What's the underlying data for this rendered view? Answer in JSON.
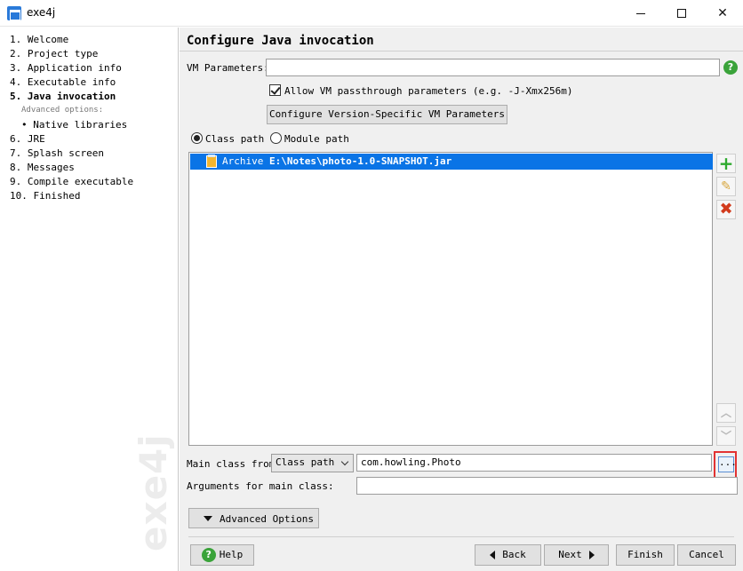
{
  "window": {
    "title": "exe4j",
    "watermark": "exe4j"
  },
  "sidebar": {
    "steps": [
      "1. Welcome",
      "2. Project type",
      "3. Application info",
      "4. Executable info",
      "5. Java invocation",
      "Advanced options:",
      "• Native libraries",
      "6. JRE",
      "7. Splash screen",
      "8. Messages",
      "9. Compile executable",
      "10. Finished"
    ]
  },
  "main": {
    "title": "Configure Java invocation",
    "vm_label": "VM Parameters:",
    "vm_value": "",
    "passthrough_label": "Allow VM passthrough parameters (e.g. -J-Xmx256m)",
    "version_button": "Configure Version-Specific VM Parameters",
    "class_path_label": "Class path",
    "module_path_label": "Module path",
    "entry_type": "Archive",
    "entry_path": "E:\\Notes\\photo-1.0-SNAPSHOT.jar",
    "main_class_label": "Main class from",
    "main_class_source": "Class path",
    "main_class_value": "com.howling.Photo",
    "browse_glyph": "...",
    "args_label": "Arguments for main class:",
    "args_value": "",
    "advanced_button": "Advanced Options"
  },
  "footer": {
    "help": "Help",
    "back": "Back",
    "next": "Next",
    "finish": "Finish",
    "cancel": "Cancel"
  },
  "icons": {
    "help": "?",
    "add": "+",
    "edit": "✎",
    "remove": "✖",
    "up": "︿",
    "down": "﹀"
  },
  "colors": {
    "selection": "#0a74e6",
    "highlight": "#e23232",
    "help_green": "#3aa33a"
  }
}
